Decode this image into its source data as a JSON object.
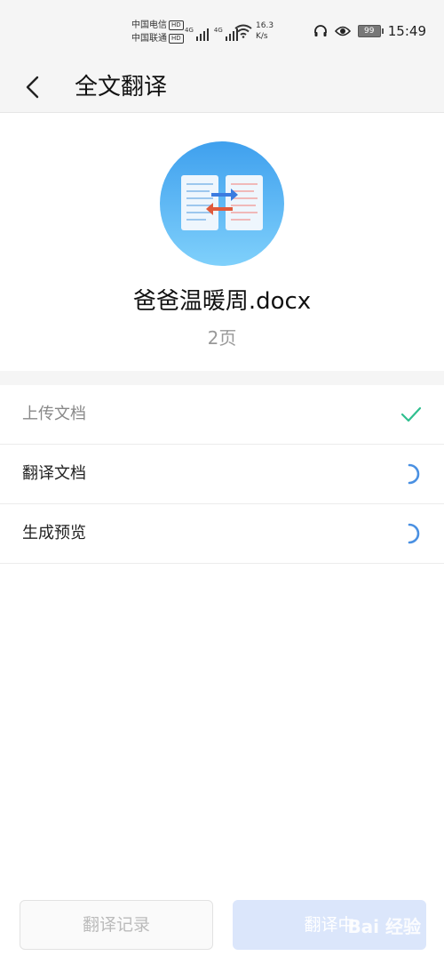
{
  "status_bar": {
    "carrier_1": "中国电信",
    "carrier_2": "中国联通",
    "hd": "HD",
    "net_1": "4G",
    "net_2": "4G",
    "speed_value": "16.3",
    "speed_unit": "K/s",
    "battery": "99",
    "time": "15:49"
  },
  "header": {
    "title": "全文翻译",
    "back_icon": "chevron-left-icon"
  },
  "file": {
    "icon": "document-translate-icon",
    "name": "爸爸温暖周.docx",
    "pages": "2页"
  },
  "steps": [
    {
      "label": "上传文档",
      "status": "done",
      "icon": "check-icon"
    },
    {
      "label": "翻译文档",
      "status": "loading",
      "icon": "spinner-icon"
    },
    {
      "label": "生成预览",
      "status": "loading",
      "icon": "spinner-icon"
    }
  ],
  "buttons": {
    "history_label": "翻译记录",
    "translating_label": "翻译中"
  },
  "watermark": "Bai 经验",
  "colors": {
    "accent": "#4a90e2",
    "check": "#2fbf8f",
    "icon_bg_top": "#3fa0ee",
    "icon_bg_bottom": "#7fd0fb",
    "arrow_blue": "#3b7be0",
    "arrow_red": "#e05a3b"
  }
}
